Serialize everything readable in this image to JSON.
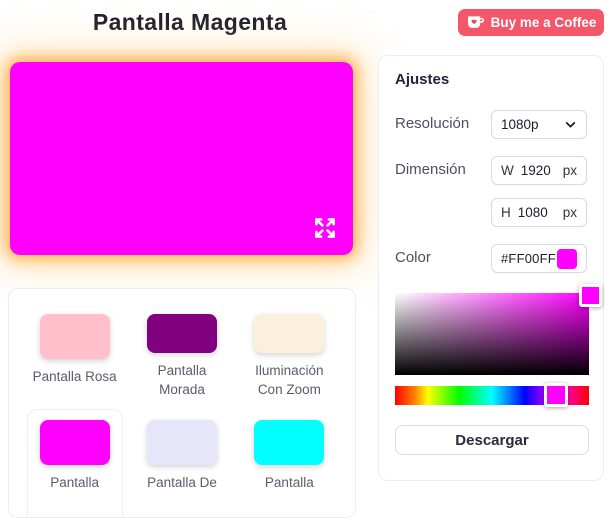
{
  "header": {
    "title": "Pantalla Magenta",
    "coffee_button_label": "Buy me a Coffee"
  },
  "preview": {
    "color": "#FF00FF"
  },
  "swatches": {
    "items": [
      {
        "label": "Pantalla Rosa",
        "color": "#FFC0CB",
        "selected": false
      },
      {
        "label": "Pantalla Morada",
        "color": "#800080",
        "selected": false
      },
      {
        "label": "Iluminación Con Zoom",
        "color": "#FAF0DC",
        "selected": false
      },
      {
        "label": "Pantalla",
        "color": "#FF00FF",
        "selected": true
      },
      {
        "label": "Pantalla De",
        "color": "#E6E6FA",
        "selected": false
      },
      {
        "label": "Pantalla",
        "color": "#00FFFF",
        "selected": false
      }
    ]
  },
  "settings": {
    "title": "Ajustes",
    "resolution_label": "Resolución",
    "resolution_value": "1080p",
    "dimension_label": "Dimensión",
    "width_prefix": "W",
    "width_value": "1920",
    "width_unit": "px",
    "height_prefix": "H",
    "height_value": "1080",
    "height_unit": "px",
    "color_label": "Color",
    "color_value": "#FF00FF",
    "download_label": "Descargar",
    "hue_percent": 83
  },
  "colors": {
    "accent": "#FF00FF",
    "coffee_red": "#F4566A",
    "glow_orange": "#FFA333"
  }
}
